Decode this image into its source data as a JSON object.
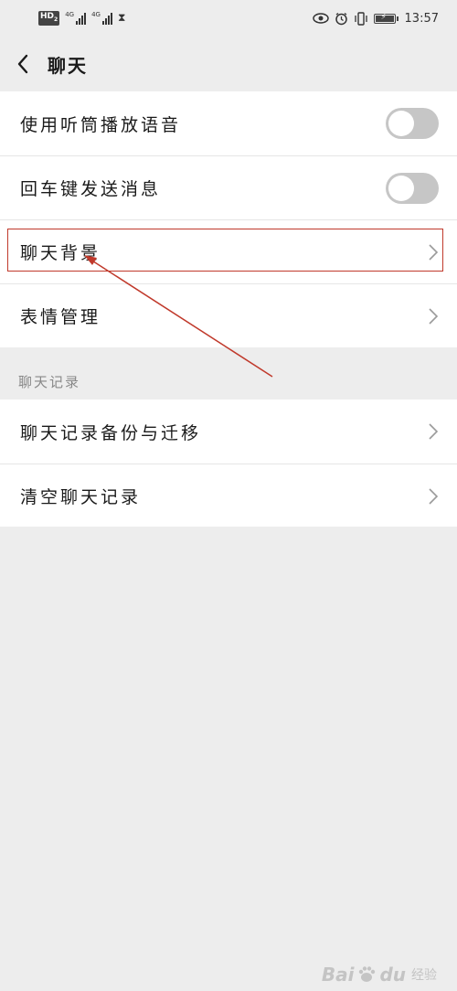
{
  "status_bar": {
    "hd": "HD",
    "hd_sub": "2",
    "net1": "4G",
    "net2": "4G",
    "time": "13:57"
  },
  "header": {
    "title": "聊天"
  },
  "settings": {
    "rows": [
      {
        "label": "使用听筒播放语音",
        "control": "toggle",
        "on": false
      },
      {
        "label": "回车键发送消息",
        "control": "toggle",
        "on": false
      },
      {
        "label": "聊天背景",
        "control": "chevron"
      },
      {
        "label": "表情管理",
        "control": "chevron"
      }
    ]
  },
  "history": {
    "section_title": "聊天记录",
    "rows": [
      {
        "label": "聊天记录备份与迁移",
        "control": "chevron"
      },
      {
        "label": "清空聊天记录",
        "control": "chevron"
      }
    ]
  },
  "annotation": {
    "color": "#c0392b"
  },
  "watermark": {
    "bai": "Bai",
    "du": "du",
    "jingyan": "经验"
  }
}
